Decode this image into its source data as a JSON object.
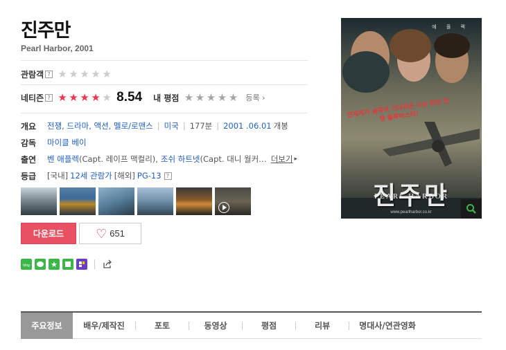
{
  "movie": {
    "title": "진주만",
    "subtitle": "Pearl Harbor, 2001"
  },
  "ratings": {
    "audience_label": "관람객",
    "audience_stars": 0,
    "netizen_label": "네티즌",
    "netizen_score": "8.54",
    "netizen_stars": 4.27,
    "my_rating_label": "내 평점",
    "my_stars": 0,
    "register_label": "등록",
    "help_glyph": "?"
  },
  "info": {
    "overview_label": "개요",
    "genres": "전쟁, 드라마, 액션, 멜로/로맨스",
    "country": "미국",
    "runtime": "177분",
    "release_date": "2001 .06.01",
    "release_suffix": "개봉",
    "director_label": "감독",
    "director": "마이클 베이",
    "cast_label": "출연",
    "cast_1_name": "벤 애플렉",
    "cast_1_role": "(Capt. 레이프 맥컬리),",
    "cast_2_name": "조쉬 하트넷",
    "cast_2_role": "(Capt. 대니 월커…",
    "more_label": "더보기",
    "grade_label": "등급",
    "domestic_prefix": "[국내]",
    "domestic_grade": "12세 관람가",
    "overseas_prefix": "[해외]",
    "overseas_grade": "PG-13"
  },
  "actions": {
    "download_label": "다운로드",
    "like_count": "651"
  },
  "share_icons": [
    "blog-icon",
    "talk-icon",
    "star-icon",
    "note-icon",
    "band-icon",
    "share-icon"
  ],
  "poster": {
    "title": "진주만",
    "subtitle": "PEARL HARBOR",
    "top_text": "에 플 렉",
    "tagline": "전세계가 숨죽여 기다려온 사상 최대 전쟁 블록버스터!",
    "url": "www.pearlharbor.co.kr"
  },
  "tabs": [
    {
      "label": "주요정보"
    },
    {
      "label": "배우/제작진"
    },
    {
      "label": "포토"
    },
    {
      "label": "동영상"
    },
    {
      "label": "평점"
    },
    {
      "label": "리뷰"
    },
    {
      "label": "명대사/연관영화"
    }
  ],
  "colors": {
    "accent_red": "#e8374a",
    "link_blue": "#1f5fbf",
    "download_bg": "#e85162"
  }
}
